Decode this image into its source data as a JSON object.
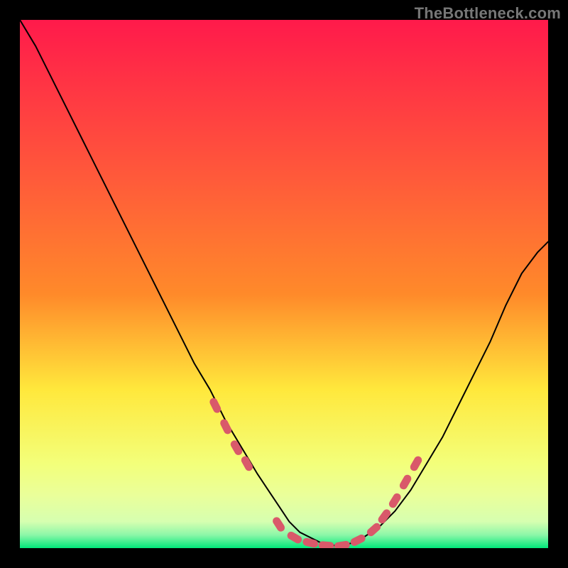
{
  "watermark": "TheBottleneck.com",
  "colors": {
    "background": "#000000",
    "gradient_top": "#ff1a4b",
    "gradient_mid1": "#ff8a2a",
    "gradient_mid2": "#ffe83c",
    "gradient_mid3": "#f3ff7a",
    "gradient_low": "#d6ffb0",
    "gradient_bottom": "#00e87a",
    "curve": "#000000",
    "marker": "#d9596a"
  },
  "chart_data": {
    "type": "line",
    "title": "",
    "xlabel": "",
    "ylabel": "",
    "xlim": [
      0,
      100
    ],
    "ylim": [
      0,
      100
    ],
    "series": [
      {
        "name": "bottleneck-curve",
        "x": [
          0,
          3,
          6,
          9,
          12,
          15,
          18,
          21,
          24,
          27,
          30,
          33,
          36,
          39,
          42,
          45,
          47,
          49,
          51,
          53,
          55,
          57,
          59,
          61,
          63,
          65,
          68,
          71,
          74,
          77,
          80,
          83,
          86,
          89,
          92,
          95,
          98,
          100
        ],
        "y": [
          100,
          95,
          89,
          83,
          77,
          71,
          65,
          59,
          53,
          47,
          41,
          35,
          30,
          24,
          19,
          14,
          11,
          8,
          5,
          3,
          2,
          1,
          0.5,
          0.5,
          1,
          2,
          4,
          7,
          11,
          16,
          21,
          27,
          33,
          39,
          46,
          52,
          56,
          58
        ]
      }
    ],
    "markers": {
      "name": "highlight-range",
      "x": [
        37,
        39,
        41,
        43,
        49,
        52,
        55,
        58,
        61,
        64,
        67,
        69,
        71,
        73,
        75
      ],
      "y": [
        27,
        23,
        19,
        16,
        4.5,
        2,
        1,
        0.5,
        0.5,
        1.5,
        3.5,
        6,
        9,
        12.5,
        16
      ]
    }
  }
}
